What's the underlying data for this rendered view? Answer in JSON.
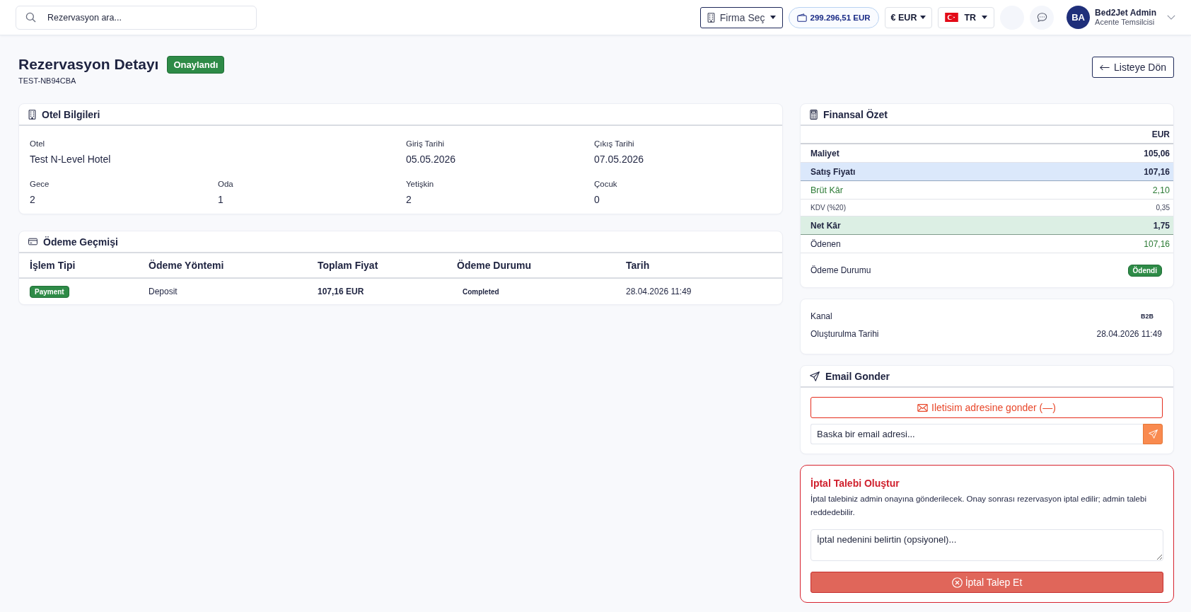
{
  "topbar": {
    "search": {
      "placeholder": "Rezervasyon ara..."
    },
    "company_select": "Firma Seç",
    "balance": "299.296,51 EUR",
    "currency_select": "€ EUR",
    "language_select": "TR",
    "user": {
      "initials": "BA",
      "name": "Bed2Jet Admin",
      "role": "Acente Temsilcisi"
    }
  },
  "header": {
    "title": "Rezervasyon Detayı",
    "status": "Onaylandı",
    "reference": "TEST-NB94CBA",
    "back_button": "Listeye Dön"
  },
  "hotel_info": {
    "title": "Otel Bilgileri",
    "rows": [
      {
        "fields": [
          {
            "label": "Otel",
            "value": "Test N-Level Hotel"
          },
          {
            "label": "Giriş Tarihi",
            "value": "05.05.2026"
          },
          {
            "label": "Çıkış Tarihi",
            "value": "07.05.2026"
          }
        ]
      },
      {
        "fields": [
          {
            "label": "Gece",
            "value": "2"
          },
          {
            "label": "Oda",
            "value": "1"
          },
          {
            "label": "Yetişkin",
            "value": "2"
          },
          {
            "label": "Çocuk",
            "value": "0"
          }
        ]
      }
    ]
  },
  "payment_history": {
    "title": "Ödeme Geçmişi",
    "columns": [
      "İşlem Tipi",
      "Ödeme Yöntemi",
      "Toplam Fiyat",
      "Ödeme Durumu",
      "Tarih"
    ],
    "rows": [
      {
        "type": "Payment",
        "method": "Deposit",
        "total": "107,16 EUR",
        "status": "Completed",
        "date": "28.04.2026 11:49"
      }
    ]
  },
  "financial_summary": {
    "title": "Finansal Özet",
    "currency": "EUR",
    "rows": [
      {
        "label": "Maliyet",
        "value": "105,06",
        "kind": "strong"
      },
      {
        "label": "Satış Fiyatı",
        "value": "107,16",
        "kind": "highlight"
      },
      {
        "label": "Brüt Kâr",
        "value": "2,10",
        "kind": "profit"
      },
      {
        "label": "KDV (%20)",
        "value": "0,35",
        "kind": "minor"
      },
      {
        "label": "Net Kâr",
        "value": "1,75",
        "kind": "net"
      },
      {
        "label": "Ödenen",
        "value": "107,16",
        "kind": "paid"
      }
    ],
    "payment_status": {
      "label": "Ödeme Durumu",
      "badge": "Ödendi"
    }
  },
  "booking_meta": {
    "rows": [
      {
        "label": "Kanal",
        "value": "B2B",
        "kind": "tag"
      },
      {
        "label": "Oluşturulma Tarihi",
        "value": "28.04.2026 11:49",
        "kind": "text"
      }
    ]
  },
  "email": {
    "title": "Email Gonder",
    "contact_button": "Iletisim adresine gonder (—)",
    "address": {
      "placeholder": "Baska bir email adresi..."
    }
  },
  "cancel_request": {
    "title": "İptal Talebi Oluştur",
    "description": "İptal talebiniz admin onayına gönderilecek. Onay sonrası rezervasyon iptal edilir; admin talebi reddedebilir.",
    "reason": {
      "placeholder": "İptal nedenini belirtin (opsiyonel)..."
    },
    "submit_button": "İptal Talep Et"
  }
}
